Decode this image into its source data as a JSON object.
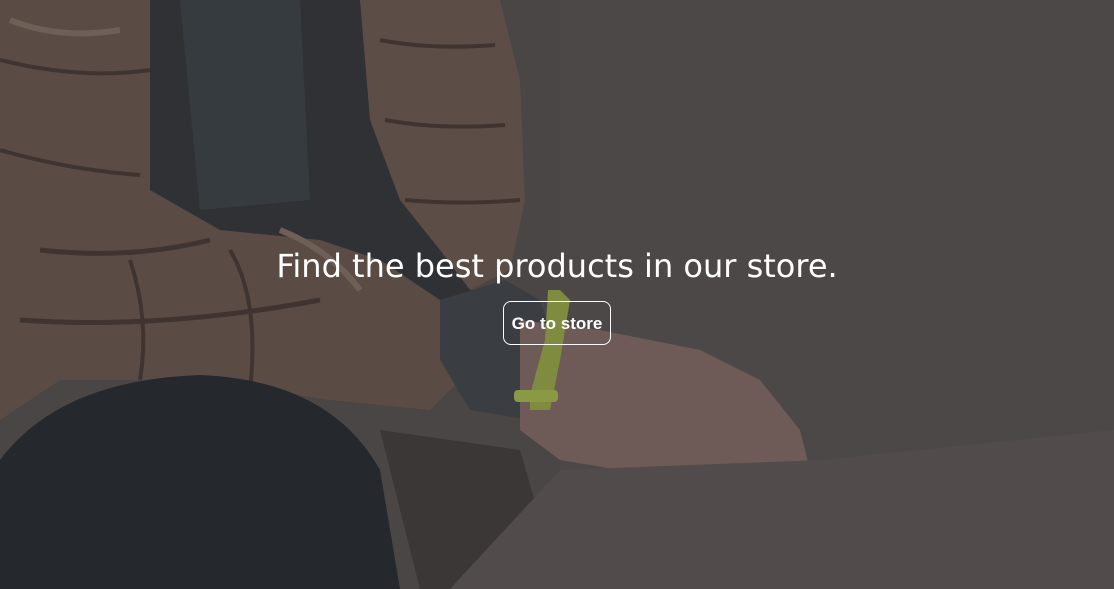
{
  "hero": {
    "headline": "Find the best products in our store.",
    "cta_label": "Go to store",
    "background_image": "person-wearing-fitness-band-photo"
  },
  "colors": {
    "overlay": "#4a4645",
    "text": "#ffffff",
    "band": "#9bad45"
  }
}
